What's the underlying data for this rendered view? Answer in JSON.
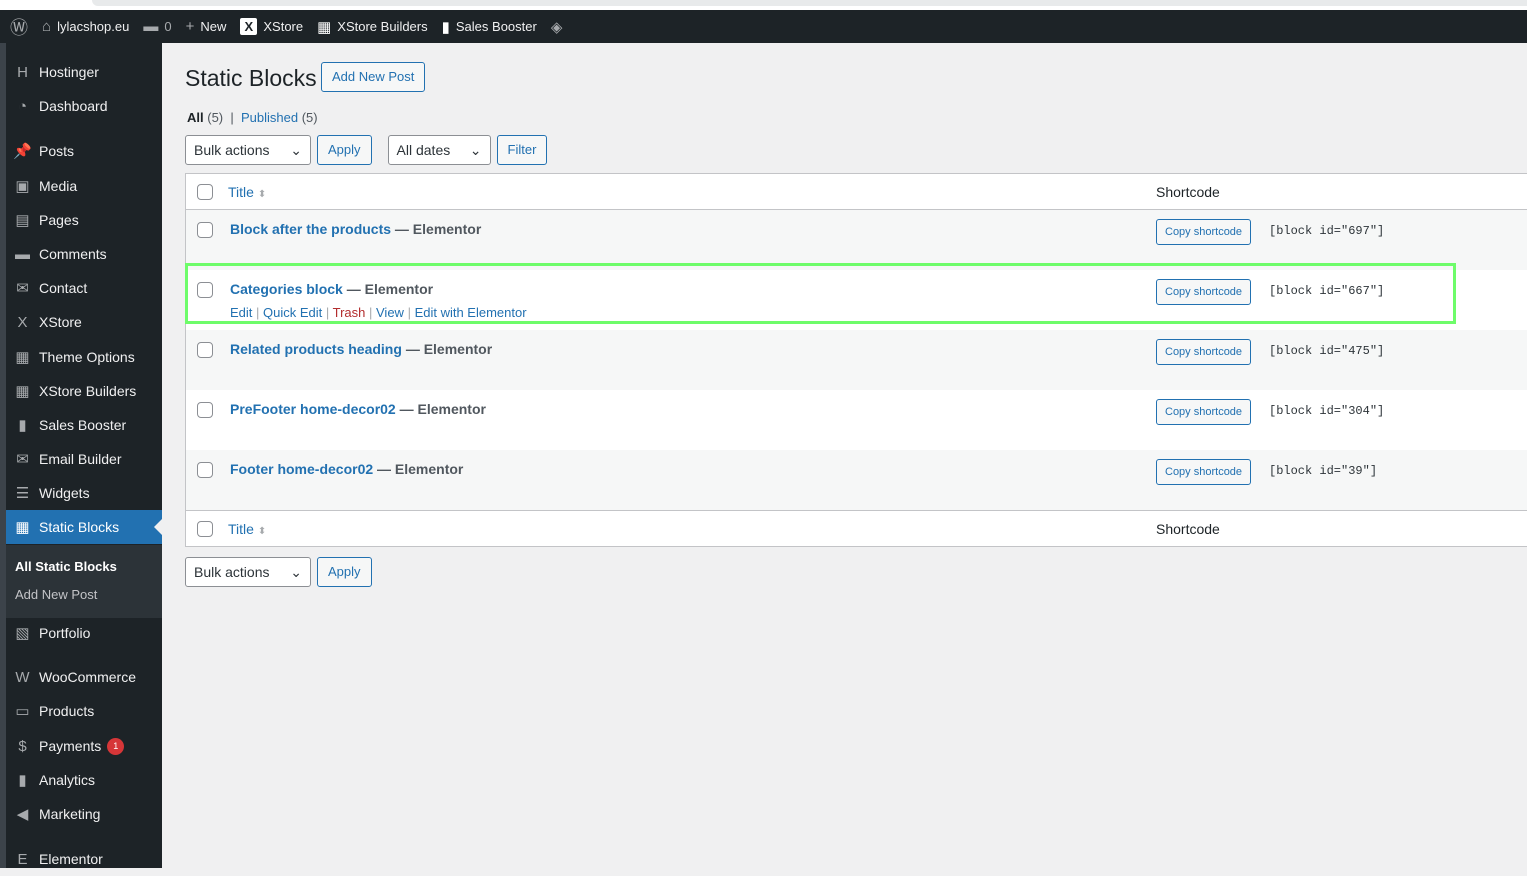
{
  "adminbar": {
    "site": "lylacshop.eu",
    "comments": "0",
    "new": "New",
    "xstore": "XStore",
    "builders": "XStore Builders",
    "booster": "Sales Booster"
  },
  "sidebar": {
    "items": [
      {
        "label": "Hostinger",
        "icon": "H"
      },
      {
        "label": "Dashboard",
        "icon": "◔"
      },
      {
        "label": "Posts",
        "icon": "📌"
      },
      {
        "label": "Media",
        "icon": "▣"
      },
      {
        "label": "Pages",
        "icon": "▤"
      },
      {
        "label": "Comments",
        "icon": "▬"
      },
      {
        "label": "Contact",
        "icon": "✉"
      },
      {
        "label": "XStore",
        "icon": "X"
      },
      {
        "label": "Theme Options",
        "icon": "▦"
      },
      {
        "label": "XStore Builders",
        "icon": "▦"
      },
      {
        "label": "Sales Booster",
        "icon": "▮"
      },
      {
        "label": "Email Builder",
        "icon": "✉"
      },
      {
        "label": "Widgets",
        "icon": "☰"
      },
      {
        "label": "Static Blocks",
        "icon": "▦"
      },
      {
        "label": "Portfolio",
        "icon": "▧"
      },
      {
        "label": "WooCommerce",
        "icon": "W"
      },
      {
        "label": "Products",
        "icon": "▭"
      },
      {
        "label": "Payments",
        "icon": "$",
        "badge": "1"
      },
      {
        "label": "Analytics",
        "icon": "▮"
      },
      {
        "label": "Marketing",
        "icon": "◀"
      },
      {
        "label": "Elementor",
        "icon": "E"
      }
    ],
    "submenu": [
      "All Static Blocks",
      "Add New Post"
    ]
  },
  "page": {
    "title": "Static Blocks",
    "add_new": "Add New Post",
    "filters": {
      "all": "All",
      "all_count": "(5)",
      "published": "Published",
      "published_count": "(5)"
    },
    "bulk": "Bulk actions",
    "apply": "Apply",
    "dates": "All dates",
    "filter": "Filter"
  },
  "table": {
    "col_title": "Title",
    "col_shortcode": "Shortcode",
    "copy": "Copy shortcode",
    "suffix": "— Elementor",
    "actions": [
      "Edit",
      "Quick Edit",
      "Trash",
      "View",
      "Edit with Elementor"
    ],
    "rows": [
      {
        "title": "Block after the products",
        "code": "[block id=\"697\"]"
      },
      {
        "title": "Categories block",
        "code": "[block id=\"667\"]"
      },
      {
        "title": "Related products heading",
        "code": "[block id=\"475\"]"
      },
      {
        "title": "PreFooter home-decor02",
        "code": "[block id=\"304\"]"
      },
      {
        "title": "Footer home-decor02",
        "code": "[block id=\"39\"]"
      }
    ]
  },
  "colors": {
    "accent": "#2271b1",
    "highlight": "#6efc6a",
    "sidebar": "#1d2327"
  }
}
